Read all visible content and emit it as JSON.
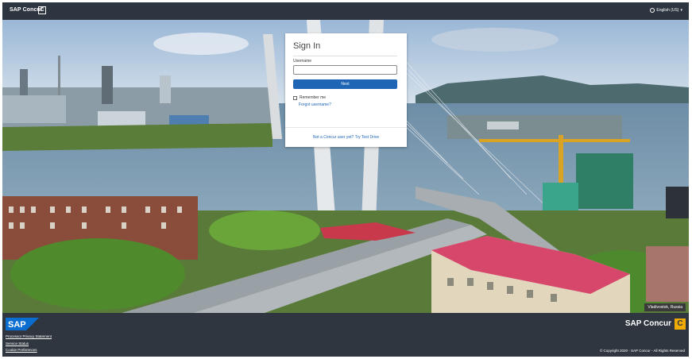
{
  "header": {
    "brand": "SAP Concur",
    "brand_mark": "C",
    "language": "English (US)",
    "globe_icon": "globe-icon",
    "caret_icon": "caret-down-icon"
  },
  "signin": {
    "title": "Sign In",
    "username_label": "Username",
    "username_value": "",
    "next_label": "Next",
    "remember_label": "Remember me",
    "forgot_label": "Forgot username?",
    "new_user_label": "Not a Concur user yet? Try Test Drive"
  },
  "photo": {
    "caption": "Vladivostok, Russia"
  },
  "footer": {
    "sap_logo_text": "SAP",
    "links": [
      "Processor Privacy Statement",
      "Service Status",
      "Cookie Preferences"
    ],
    "brand": "SAP Concur",
    "brand_mark": "C",
    "copyright": "© Copyright 2020 - SAP Concur - All Rights Reserved"
  },
  "colors": {
    "topbar": "#2d3540",
    "primary_button": "#1e65b6",
    "concur_yellow": "#f0ab00",
    "sap_blue": "#0a6ed1"
  }
}
